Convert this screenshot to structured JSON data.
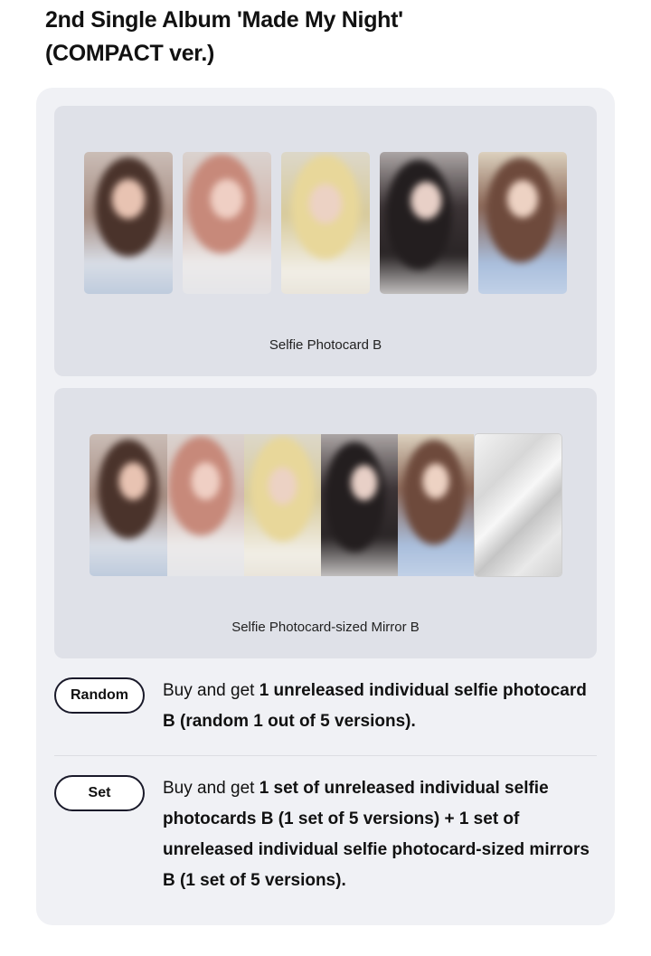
{
  "title_line1": "2nd Single Album 'Made My Night'",
  "title_line2": "(COMPACT ver.)",
  "cards": {
    "photocard": {
      "caption": "Selfie Photocard B"
    },
    "mirror": {
      "caption": "Selfie Photocard-sized Mirror B"
    }
  },
  "options": [
    {
      "badge": "Random",
      "lead": "Buy and get ",
      "bold": "1 unreleased individual selfie photocard B (random 1 out of 5 versions)."
    },
    {
      "badge": "Set",
      "lead": "Buy and get ",
      "bold": "1 set of unreleased individual selfie photocards B (1 set of 5 versions) + 1 set of unreleased individual selfie photocard-sized mirrors B (1 set of 5 versions)."
    }
  ],
  "colors": {
    "panel_bg": "#f0f1f5",
    "card_bg": "#dfe1e8",
    "badge_border": "#1a1a2a"
  }
}
